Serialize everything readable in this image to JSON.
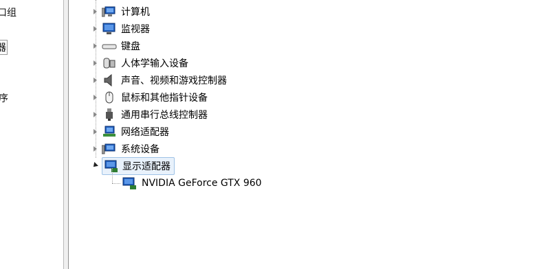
{
  "left_panel": {
    "fragments": [
      "口组",
      "器",
      "序",
      "："
    ]
  },
  "tree": {
    "items": [
      {
        "label": "计算机",
        "icon": "computer-icon",
        "expanded": false
      },
      {
        "label": "监视器",
        "icon": "monitor-icon",
        "expanded": false
      },
      {
        "label": "键盘",
        "icon": "keyboard-icon",
        "expanded": false
      },
      {
        "label": "人体学输入设备",
        "icon": "hid-icon",
        "expanded": false
      },
      {
        "label": "声音、视频和游戏控制器",
        "icon": "speaker-icon",
        "expanded": false
      },
      {
        "label": "鼠标和其他指针设备",
        "icon": "mouse-icon",
        "expanded": false
      },
      {
        "label": "通用串行总线控制器",
        "icon": "usb-icon",
        "expanded": false
      },
      {
        "label": "网络适配器",
        "icon": "network-adapter-icon",
        "expanded": false
      },
      {
        "label": "系统设备",
        "icon": "system-device-icon",
        "expanded": false
      },
      {
        "label": "显示适配器",
        "icon": "display-adapter-icon",
        "expanded": true,
        "selected": true
      }
    ],
    "child": {
      "label": "NVIDIA GeForce GTX 960",
      "icon": "display-adapter-icon"
    }
  },
  "colors": {
    "selection_bg": "#e8f1fb",
    "selection_border": "#9ec2e6",
    "icon_blue": "#1f5fbf"
  }
}
